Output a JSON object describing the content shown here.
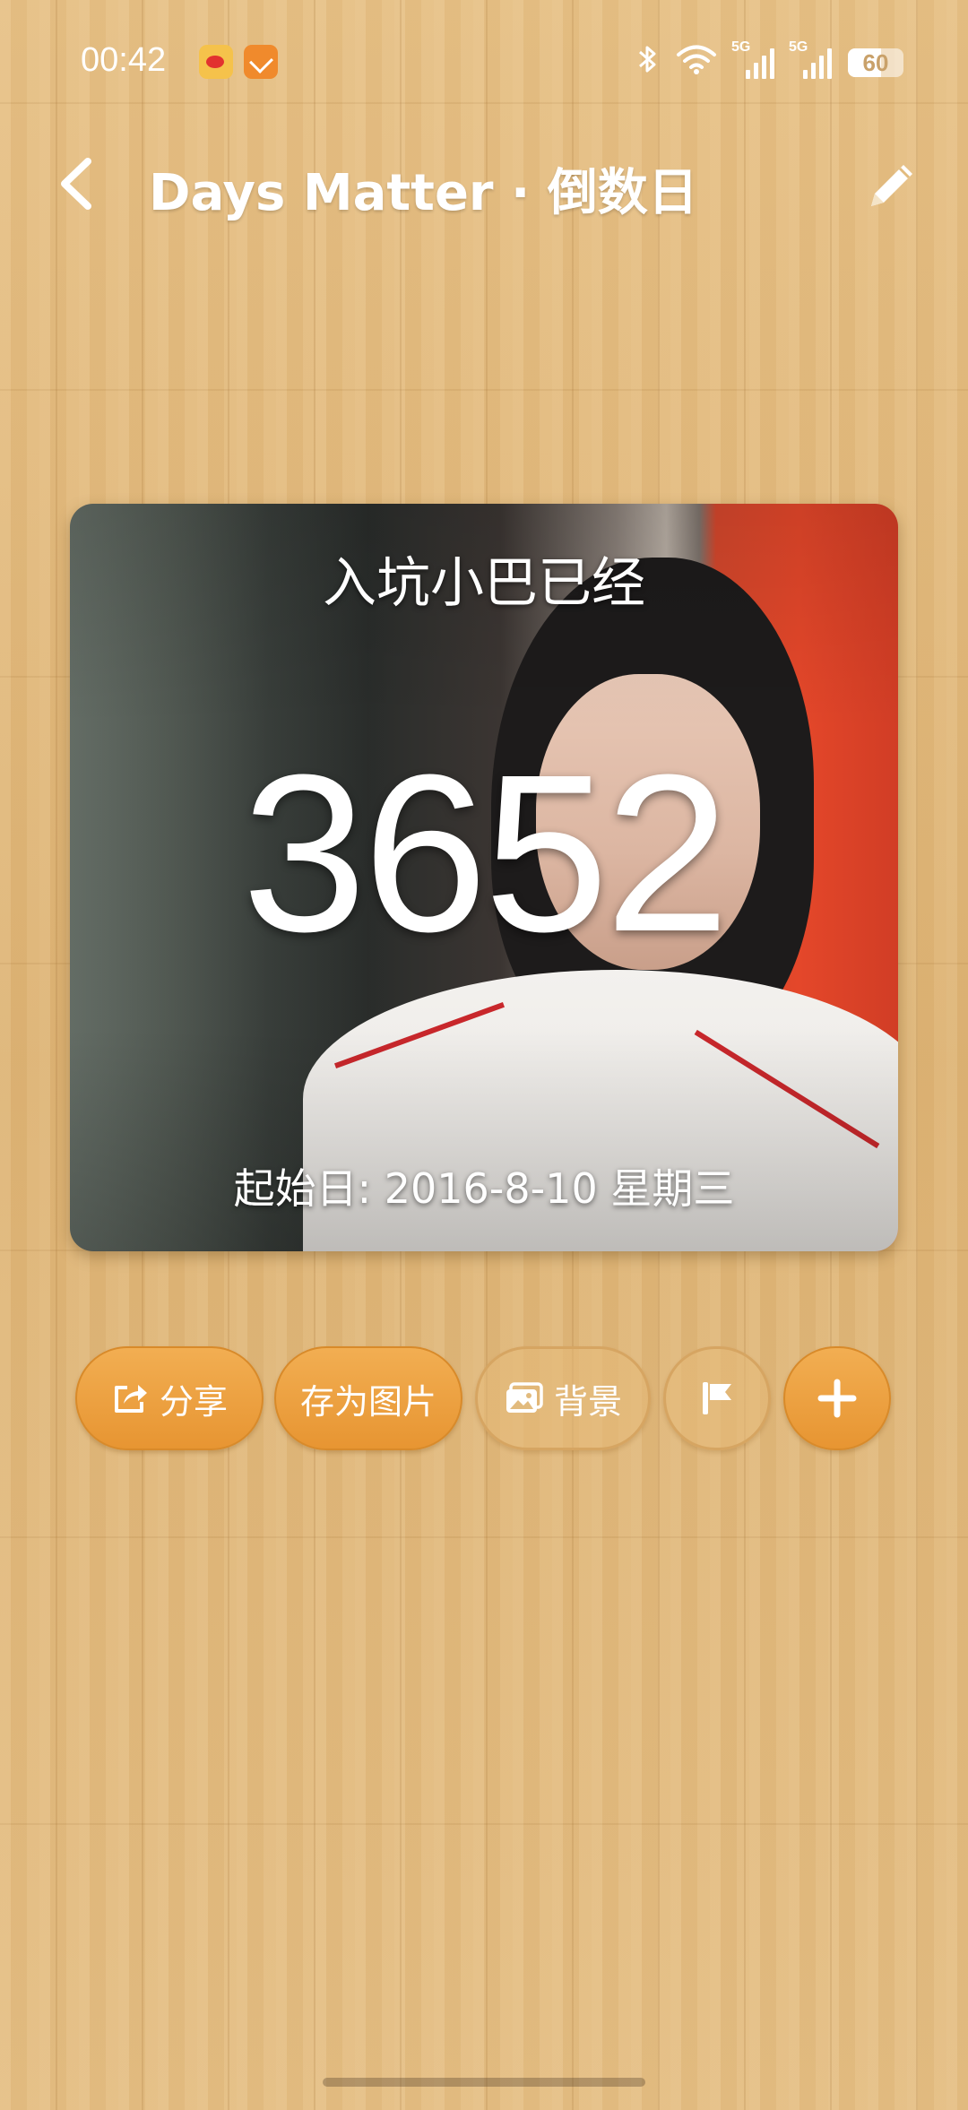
{
  "status_bar": {
    "time": "00:42",
    "app_icons": [
      "weibo-icon",
      "notification-app-icon"
    ],
    "signal_1_tag": "5G",
    "signal_2_tag": "5G",
    "battery_level": "60",
    "battery_fraction": 0.6
  },
  "app_bar": {
    "title": "Days Matter · 倒数日",
    "back_icon": "chevron-left-icon",
    "edit_icon": "pencil-icon"
  },
  "event_card": {
    "title": "入坑小巴已经",
    "count": "3652",
    "start_date": "起始日: 2016-8-10 星期三"
  },
  "actions": {
    "share_label": "分享",
    "save_image_label": "存为图片",
    "background_label": "背景",
    "flag_icon": "flag-icon",
    "add_icon": "plus-icon"
  },
  "colors": {
    "accent": "#E89A38",
    "wood": "#E2BB7E"
  }
}
